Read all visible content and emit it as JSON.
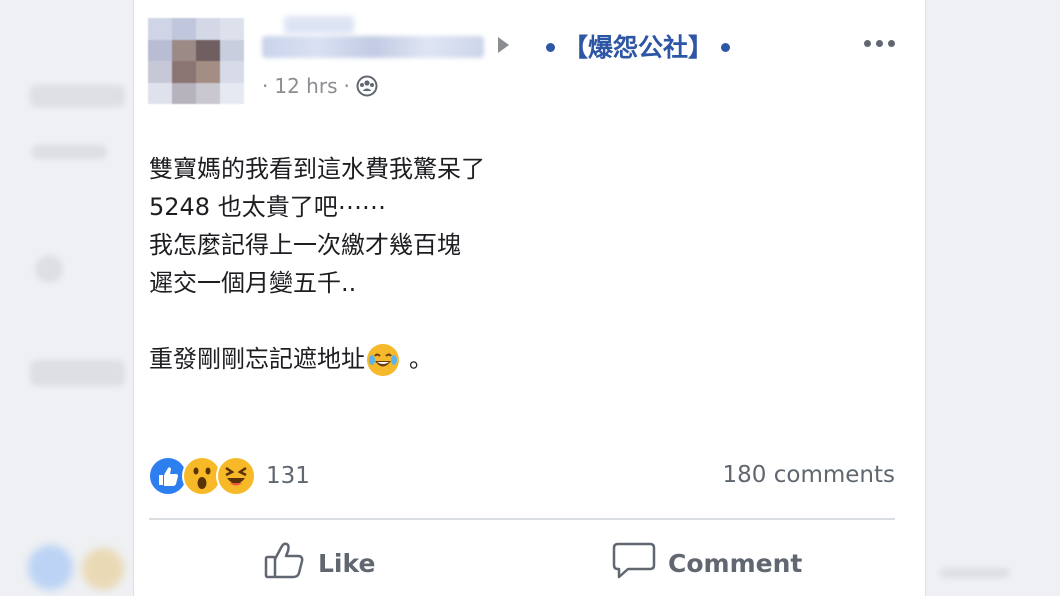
{
  "post": {
    "group_name": "【爆怨公社】",
    "timestamp": "12 hrs",
    "separator": "·",
    "body_lines": [
      "雙寶媽的我看到這水費我驚呆了",
      "5248 也太貴了吧⋯⋯",
      "我怎麼記得上一次繳才幾百塊",
      "遲交一個月變五千..",
      "",
      "重發剛剛忘記遮地址"
    ],
    "body_trailing": "。",
    "reaction_count": "131",
    "comments_count": "180 comments",
    "actions": {
      "like_label": "Like",
      "comment_label": "Comment"
    }
  },
  "colors": {
    "group_blue": "#2d56a5",
    "like_blue": "#2d7ff0",
    "emoji_yellow": "#f7b928",
    "meta_gray": "#8a8d91"
  },
  "icons": [
    "audience-icon",
    "like-reaction-icon",
    "wow-reaction-icon",
    "haha-reaction-icon",
    "thumbs-up-icon",
    "comment-bubble-icon",
    "more-options-icon",
    "laughing-tears-emoji"
  ]
}
